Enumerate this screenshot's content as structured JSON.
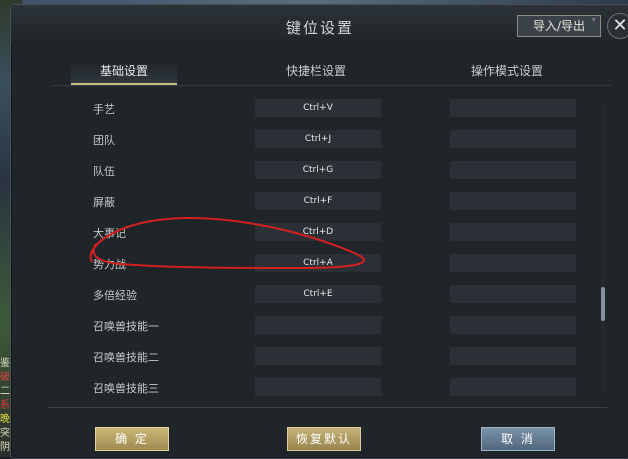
{
  "window": {
    "title": "键位设置"
  },
  "header": {
    "import_export_label": "导入/导出",
    "import_dot": "˚",
    "close_glyph": "✕"
  },
  "tabs": [
    {
      "label": "基础设置",
      "active": true
    },
    {
      "label": "快捷栏设置",
      "active": false
    },
    {
      "label": "操作模式设置",
      "active": false
    }
  ],
  "rows": [
    {
      "label": "手艺",
      "shortcut": "Ctrl+V",
      "mode_key": ""
    },
    {
      "label": "团队",
      "shortcut": "Ctrl+J",
      "mode_key": ""
    },
    {
      "label": "队伍",
      "shortcut": "Ctrl+G",
      "mode_key": ""
    },
    {
      "label": "屏蔽",
      "shortcut": "Ctrl+F",
      "mode_key": ""
    },
    {
      "label": "大事记",
      "shortcut": "Ctrl+D",
      "mode_key": ""
    },
    {
      "label": "势力战",
      "shortcut": "Ctrl+A",
      "mode_key": ""
    },
    {
      "label": "多倍经验",
      "shortcut": "Ctrl+E",
      "mode_key": ""
    },
    {
      "label": "召唤兽技能一",
      "shortcut": "",
      "mode_key": ""
    },
    {
      "label": "召唤兽技能二",
      "shortcut": "",
      "mode_key": ""
    },
    {
      "label": "召唤兽技能三",
      "shortcut": "",
      "mode_key": ""
    }
  ],
  "footer": {
    "confirm_label": "确 定",
    "reset_label": "恢复默认",
    "cancel_label": "取 消"
  },
  "background": {
    "left_strip_chars": [
      "鉴",
      "破",
      "二",
      "系",
      "晚",
      "突",
      "阴"
    ]
  },
  "colors": {
    "accent_gold": "#c9b98a",
    "annotation_red": "#d42020"
  }
}
